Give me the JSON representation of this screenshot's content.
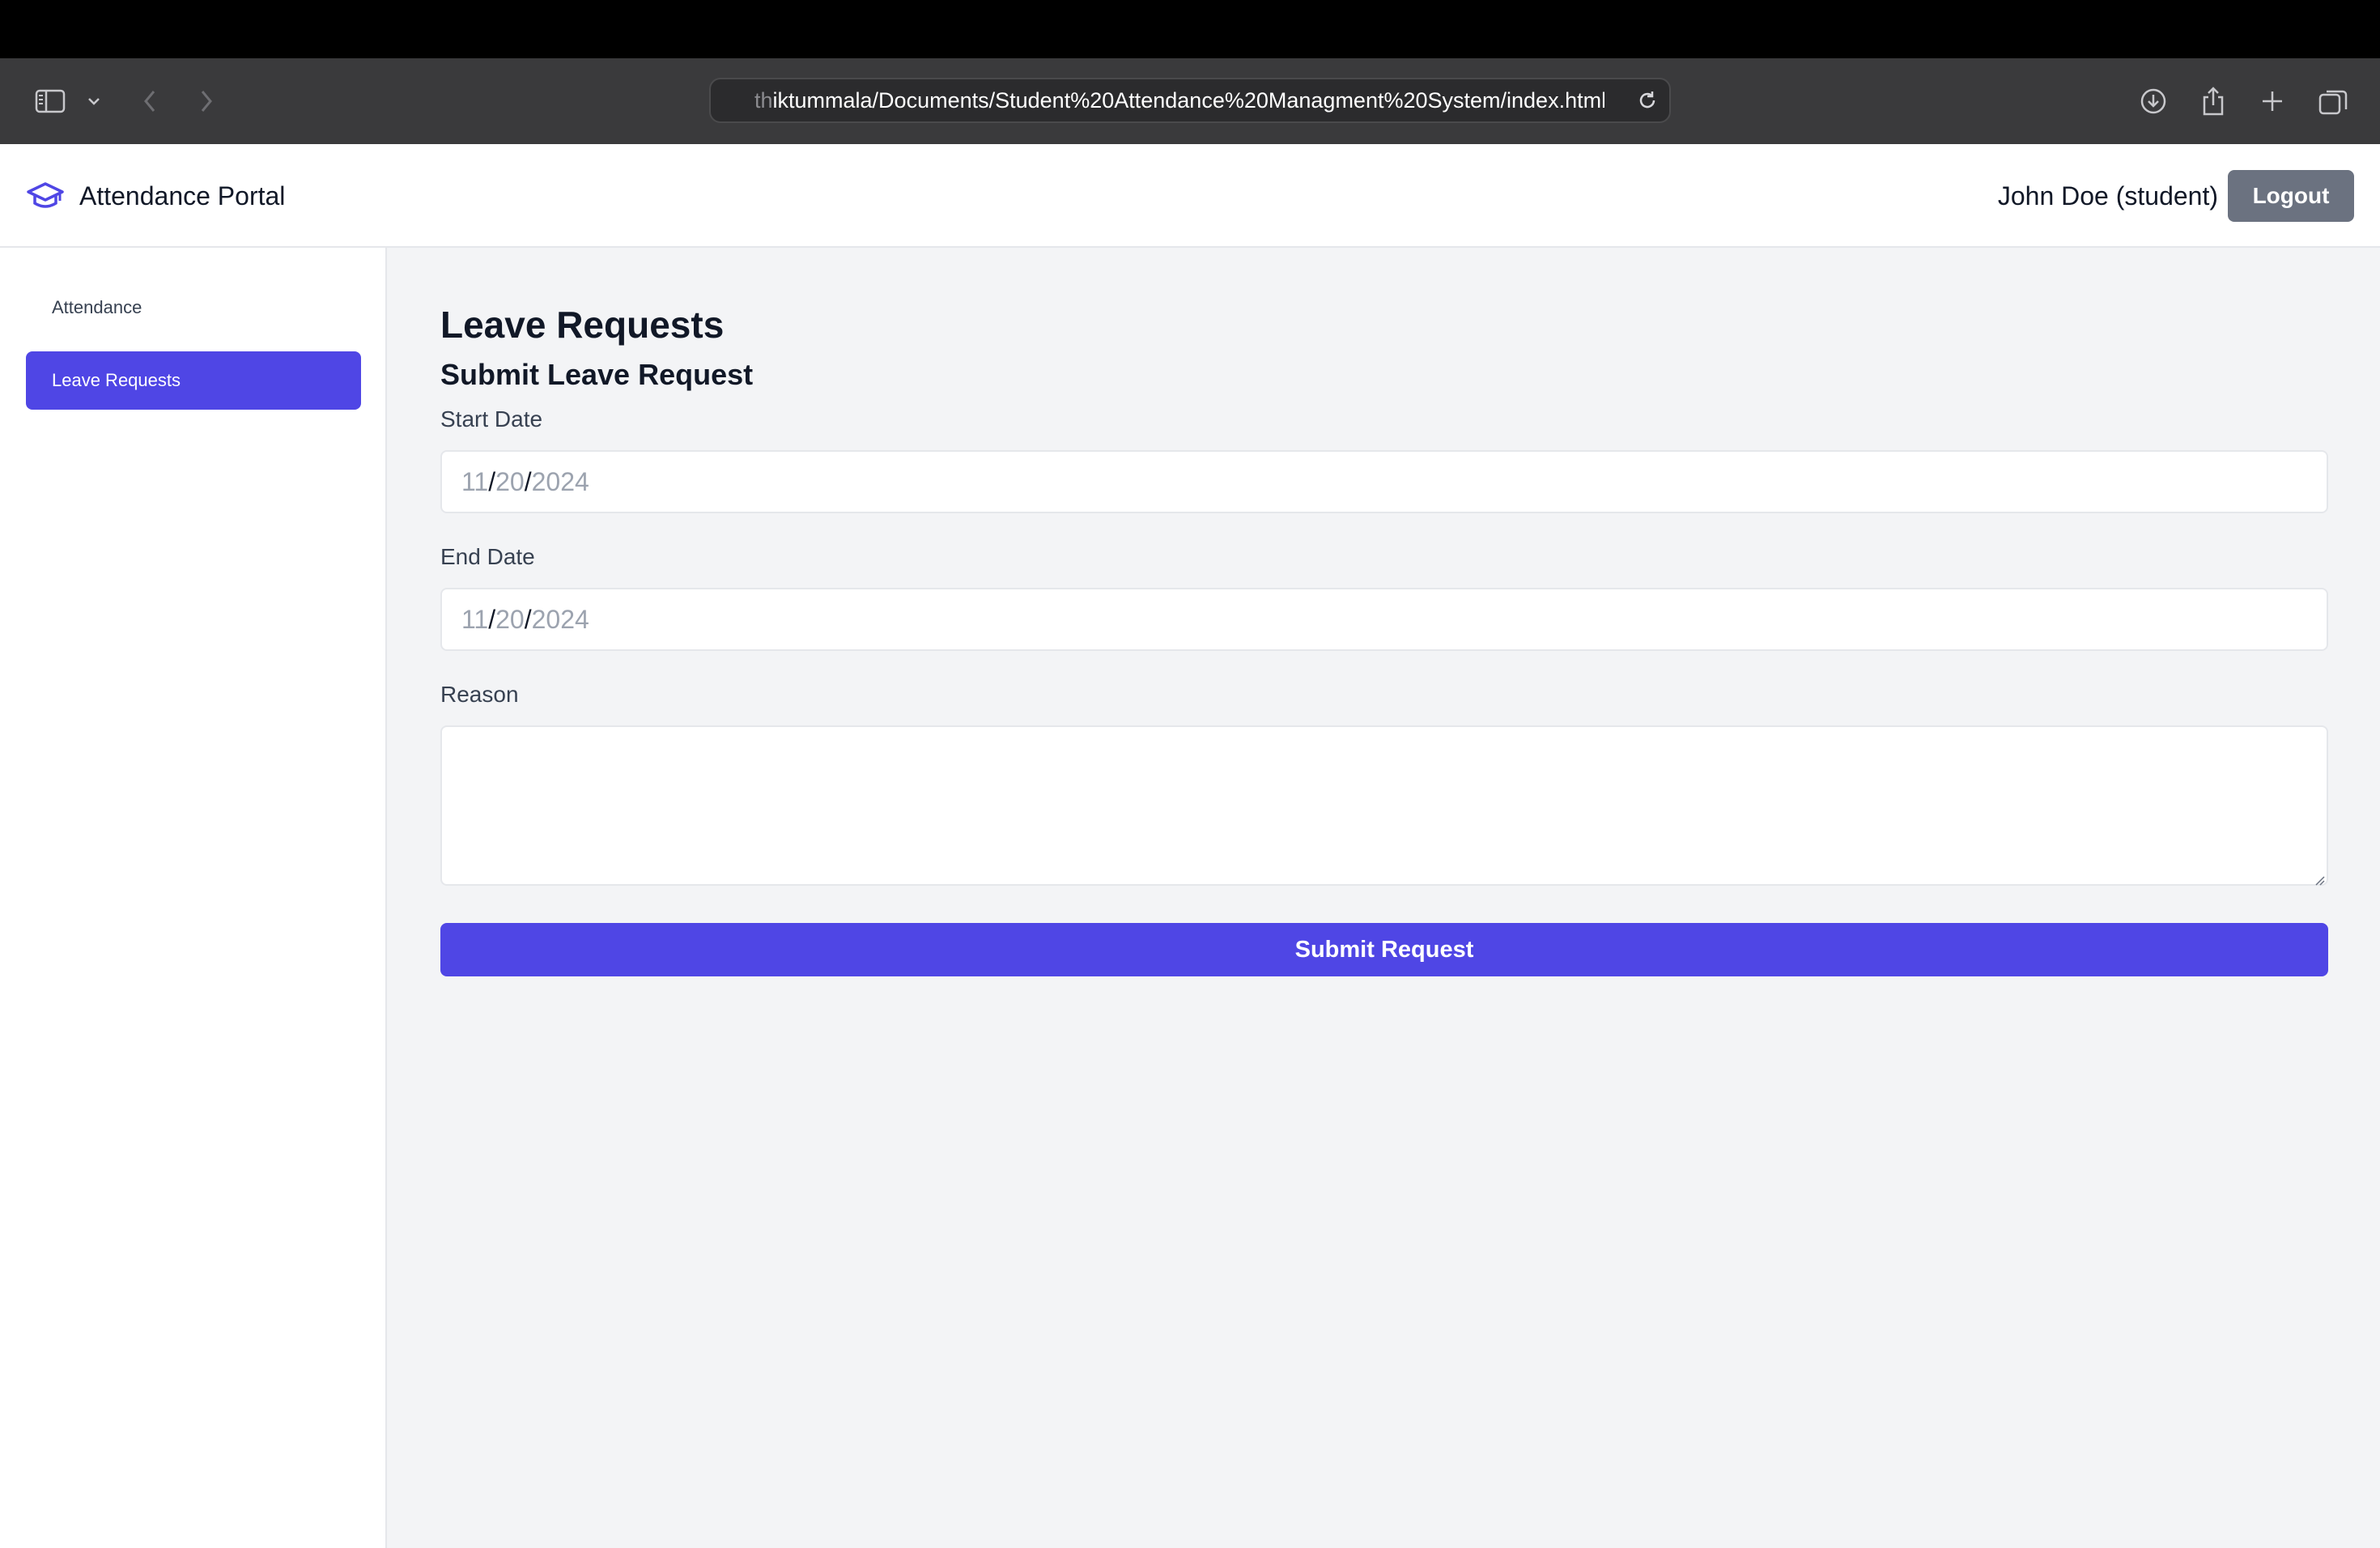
{
  "browser": {
    "url_faded": "th",
    "url_main": "iktummala/Documents/Student%20Attendance%20Managment%20System/index.html"
  },
  "header": {
    "brand": "Attendance Portal",
    "brand_icon": "graduation-cap-icon",
    "user_label": "John Doe (student)",
    "logout_label": "Logout"
  },
  "sidebar": {
    "items": [
      {
        "label": "Attendance",
        "active": false
      },
      {
        "label": "Leave Requests",
        "active": true
      }
    ]
  },
  "main": {
    "title": "Leave Requests",
    "form_title": "Submit Leave Request",
    "start_date": {
      "label": "Start Date",
      "month": "11",
      "day": "20",
      "year": "2024"
    },
    "end_date": {
      "label": "End Date",
      "month": "11",
      "day": "20",
      "year": "2024"
    },
    "reason": {
      "label": "Reason",
      "value": ""
    },
    "submit_label": "Submit Request"
  },
  "colors": {
    "accent": "#4f46e5",
    "logout_bg": "#6b7280",
    "page_bg": "#f3f4f6"
  }
}
